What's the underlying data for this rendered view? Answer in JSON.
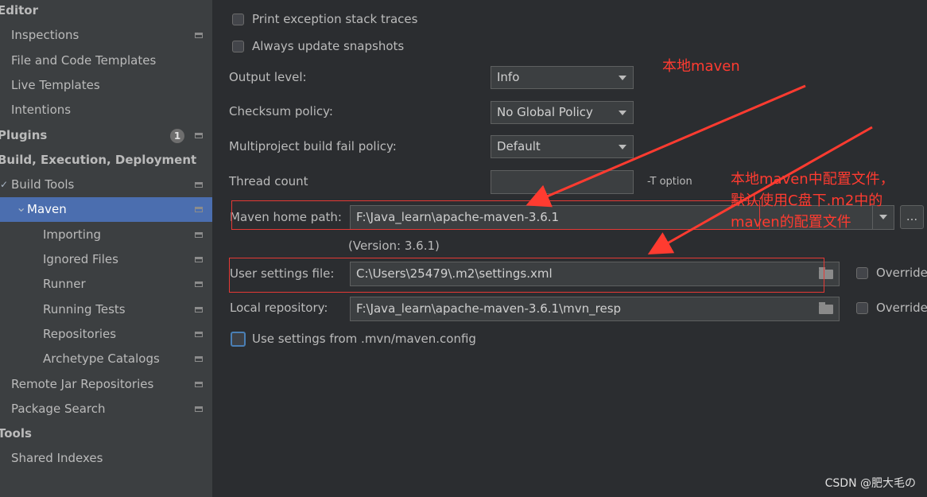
{
  "sidebar": {
    "items": [
      {
        "label": "Editor",
        "indent": 0,
        "bold": true
      },
      {
        "label": "Inspections",
        "indent": 1,
        "gear": true
      },
      {
        "label": "File and Code Templates",
        "indent": 1
      },
      {
        "label": "Live Templates",
        "indent": 1
      },
      {
        "label": "Intentions",
        "indent": 1
      },
      {
        "label": "Plugins",
        "indent": 0,
        "bold": true,
        "badge": "1",
        "gear": true
      },
      {
        "label": "Build, Execution, Deployment",
        "indent": 0,
        "bold": true
      },
      {
        "label": "Build Tools",
        "indent": 1,
        "expanded": true,
        "gear": true
      },
      {
        "label": "Maven",
        "indent": 2,
        "expanded": true,
        "selected": true,
        "gear": true
      },
      {
        "label": "Importing",
        "indent": 3,
        "gear": true
      },
      {
        "label": "Ignored Files",
        "indent": 3,
        "gear": true
      },
      {
        "label": "Runner",
        "indent": 3,
        "gear": true
      },
      {
        "label": "Running Tests",
        "indent": 3,
        "gear": true
      },
      {
        "label": "Repositories",
        "indent": 3,
        "gear": true
      },
      {
        "label": "Archetype Catalogs",
        "indent": 3,
        "gear": true
      },
      {
        "label": "Remote Jar Repositories",
        "indent": 1,
        "gear": true
      },
      {
        "label": "Package Search",
        "indent": 1,
        "gear": true
      },
      {
        "label": "Tools",
        "indent": 0,
        "bold": true
      },
      {
        "label": "Shared Indexes",
        "indent": 1
      }
    ]
  },
  "settings": {
    "print_exception": {
      "label": "Print exception stack traces",
      "checked": false
    },
    "always_update": {
      "label": "Always update snapshots",
      "checked": false
    },
    "output_level": {
      "label": "Output level:",
      "value": "Info"
    },
    "checksum_policy": {
      "label": "Checksum policy:",
      "value": "No Global Policy"
    },
    "multiproject_fail": {
      "label": "Multiproject build fail policy:",
      "value": "Default"
    },
    "thread_count": {
      "label": "Thread count",
      "value": "",
      "hint": "-T option"
    },
    "maven_home": {
      "label": "Maven home path:",
      "value": "F:\\Java_learn\\apache-maven-3.6.1",
      "version": "(Version: 3.6.1)",
      "browse_label": "..."
    },
    "user_settings": {
      "label": "User settings file:",
      "value": "C:\\Users\\25479\\.m2\\settings.xml",
      "override_label": "Override"
    },
    "local_repo": {
      "label": "Local repository:",
      "value": "F:\\Java_learn\\apache-maven-3.6.1\\mvn_resp",
      "override_label": "Override"
    },
    "use_mvn_config": {
      "label": "Use settings from .mvn/maven.config",
      "checked": false
    }
  },
  "annotations": {
    "local_maven": "本地maven",
    "settings_note_line1": "本地maven中配置文件，",
    "settings_note_line2": "默认使用C盘下.m2中的",
    "settings_note_line3": "maven的配置文件"
  },
  "watermark": "CSDN @肥大毛の",
  "colors": {
    "accent": "#4b6eaf",
    "annotation": "#ff3b30",
    "sidebar_bg": "#3c3f41",
    "panel_bg": "#2b2d30"
  }
}
